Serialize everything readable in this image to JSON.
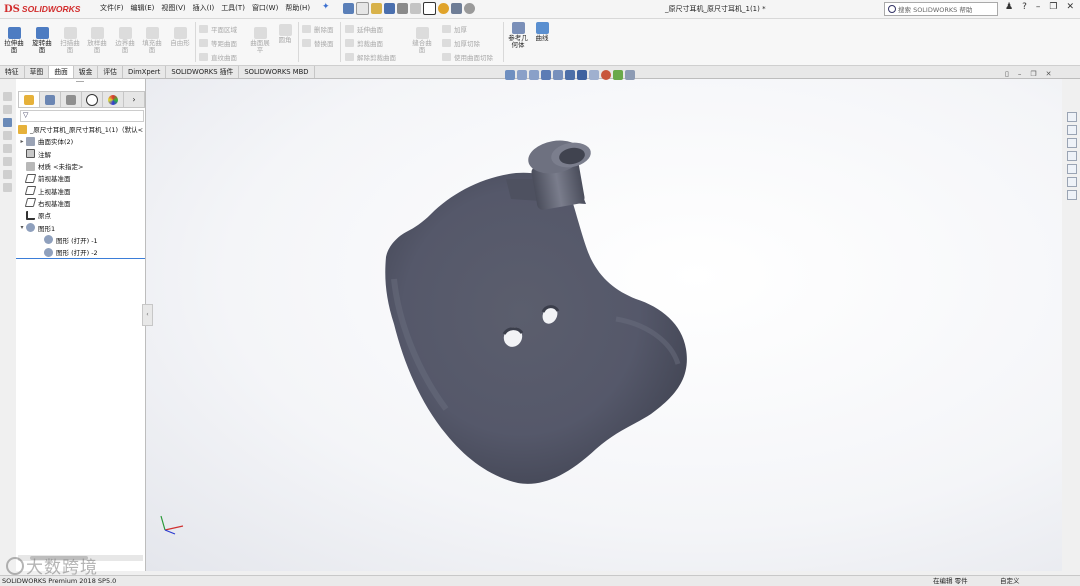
{
  "app": {
    "brand_mark": "DS",
    "brand_name": "SOLIDWORKS"
  },
  "menu": [
    "文件(F)",
    "编辑(E)",
    "视图(V)",
    "插入(I)",
    "工具(T)",
    "窗口(W)",
    "帮助(H)"
  ],
  "document_title": "_原尺寸耳机_原尺寸耳机_1(1) *",
  "search": {
    "placeholder": "搜索 SOLIDWORKS 帮助"
  },
  "ribbon": {
    "extrude_surface": "拉伸曲面",
    "revolve_surface": "旋转曲面",
    "sweep_surface": "扫描曲面",
    "loft_surface": "放样曲面",
    "boundary_surface": "边界曲面",
    "fill_surface": "填充曲面",
    "freeform": "自由形",
    "planar": "平面区域",
    "offset": "等距曲面",
    "ruled": "直纹曲面",
    "surface_flatten": "曲面展平",
    "delete_face": "删除面",
    "replace_face": "替换面",
    "extend_surface": "延伸曲面",
    "trim_surface": "剪裁曲面",
    "untrim_surface": "解除剪裁曲面",
    "knit_surface": "缝合曲面",
    "thicken": "加厚",
    "thicken_cut": "加厚切除",
    "cut_with_surface": "使用曲面切除",
    "fillet": "圆角",
    "ref_geometry": "参考几何体",
    "curves": "曲线"
  },
  "tabs": [
    "特征",
    "草图",
    "曲面",
    "钣金",
    "评估",
    "DimXpert",
    "SOLIDWORKS 插件",
    "SOLIDWORKS MBD"
  ],
  "active_tab": "曲面",
  "tree": {
    "root": "_原尺寸耳机_原尺寸耳机_1(1)（默认<",
    "items": [
      {
        "label": "曲面实体(2)",
        "indent": 1,
        "expandable": true
      },
      {
        "label": "注解",
        "indent": 1
      },
      {
        "label": "材质 <未指定>",
        "indent": 1
      },
      {
        "label": "前视基准面",
        "indent": 1
      },
      {
        "label": "上视基准面",
        "indent": 1
      },
      {
        "label": "右视基准面",
        "indent": 1
      },
      {
        "label": "原点",
        "indent": 1
      },
      {
        "label": "图形1",
        "indent": 1,
        "expandable": true,
        "expanded": true
      },
      {
        "label": "图形 (打开) -1",
        "indent": 2
      },
      {
        "label": "图形 (打开) -2",
        "indent": 2
      }
    ]
  },
  "status": {
    "version": "SOLIDWORKS Premium 2018 SP5.0",
    "editing": "在编辑 零件",
    "units": "自定义"
  },
  "watermark": "大数跨境",
  "colors": {
    "model": "#5f6270",
    "accent": "#3b7dd8",
    "brand": "#d22d2d"
  }
}
